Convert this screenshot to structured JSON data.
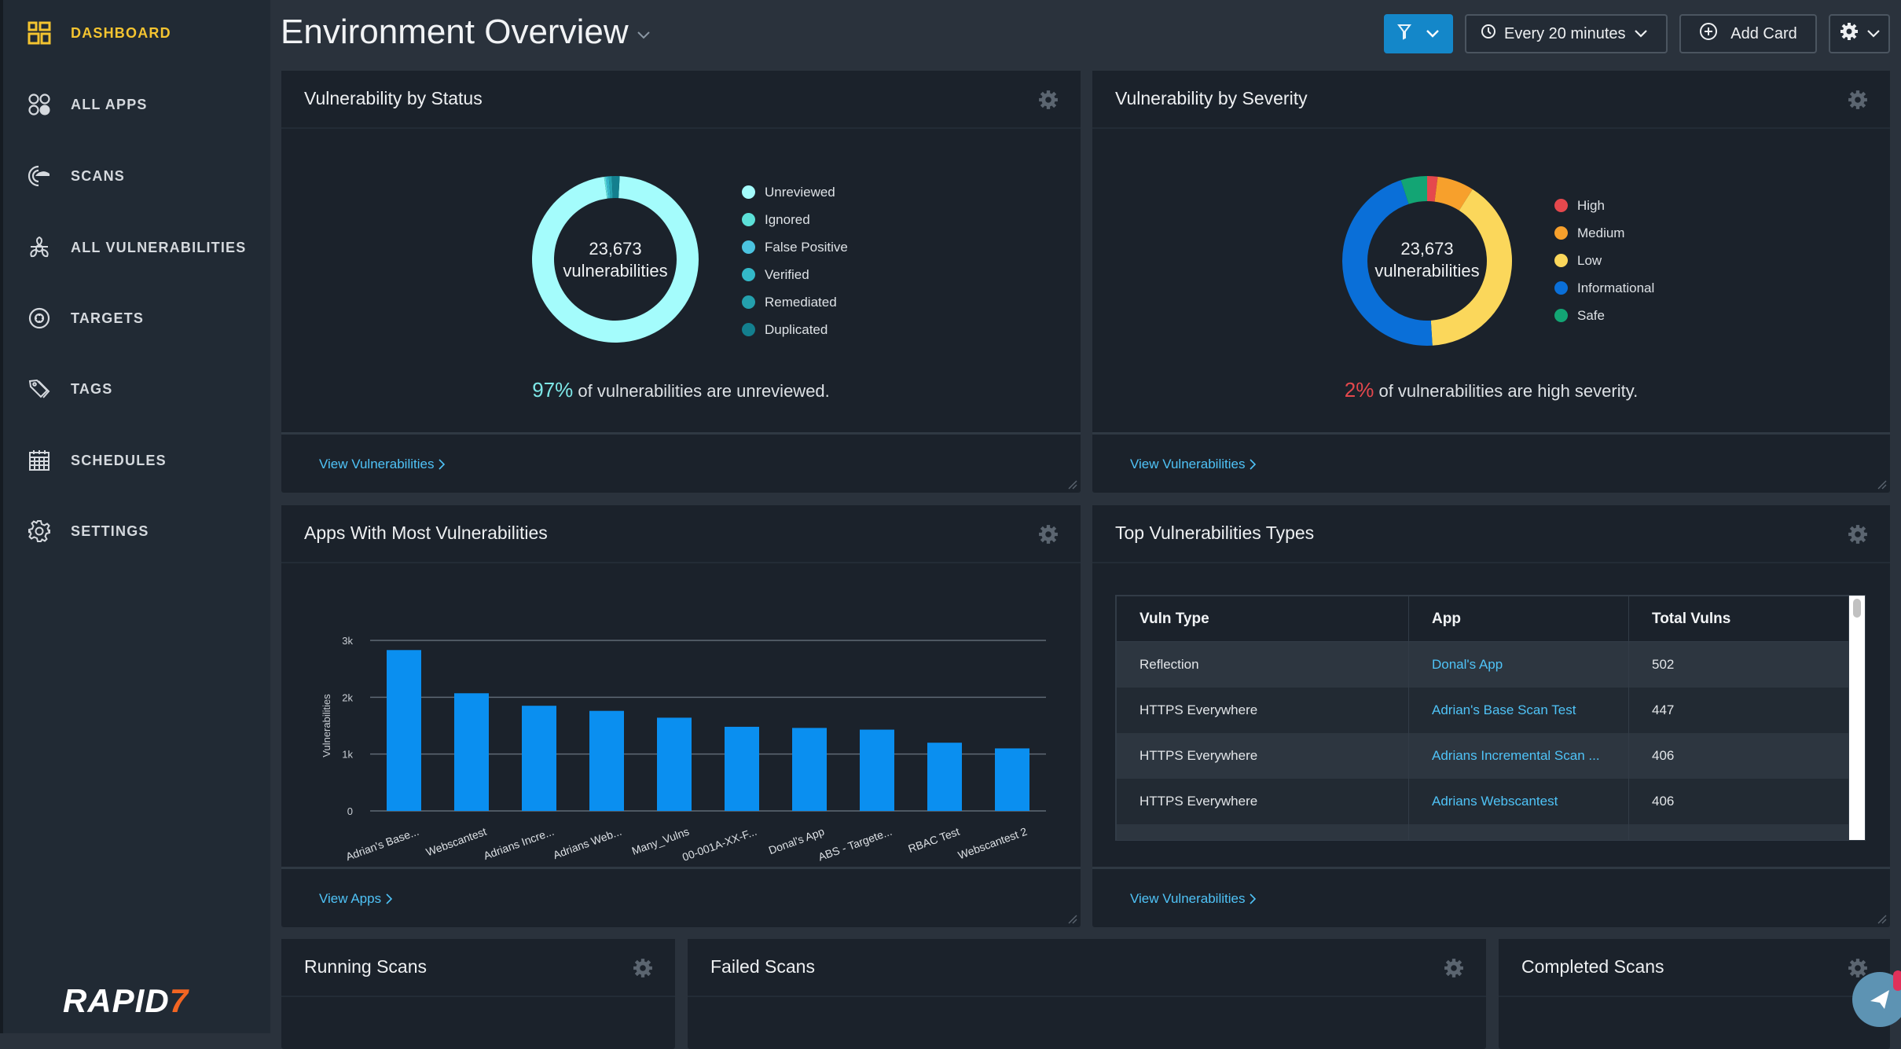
{
  "sidebar": {
    "items": [
      {
        "label": "DASHBOARD",
        "icon": "dashboard-grid-icon",
        "active": true
      },
      {
        "label": "ALL APPS",
        "icon": "apps-circles-icon"
      },
      {
        "label": "SCANS",
        "icon": "scans-radar-icon"
      },
      {
        "label": "ALL VULNERABILITIES",
        "icon": "biohazard-icon"
      },
      {
        "label": "TARGETS",
        "icon": "target-icon"
      },
      {
        "label": "TAGS",
        "icon": "tags-icon"
      },
      {
        "label": "SCHEDULES",
        "icon": "calendar-icon"
      },
      {
        "label": "SETTINGS",
        "icon": "gear-icon"
      }
    ],
    "logo": {
      "text": "RAPID",
      "mark": "7"
    }
  },
  "header": {
    "title": "Environment Overview",
    "refresh_label": "Every 20 minutes",
    "add_card_label": "Add Card"
  },
  "cards": {
    "status": {
      "title": "Vulnerability by Status",
      "total": "23,673",
      "total_label": "vulnerabilities",
      "summary_pct": "97%",
      "summary_text": " of vulnerabilities are unreviewed.",
      "summary_color": "#7ee8e8",
      "link": "View Vulnerabilities"
    },
    "severity": {
      "title": "Vulnerability by Severity",
      "total": "23,673",
      "total_label": "vulnerabilities",
      "summary_pct": "2%",
      "summary_text": " of vulnerabilities are high severity.",
      "summary_color": "#e5484d",
      "link": "View Vulnerabilities"
    },
    "apps": {
      "title": "Apps With Most Vulnerabilities",
      "link": "View Apps"
    },
    "types": {
      "title": "Top Vulnerabilities Types",
      "columns": [
        "Vuln Type",
        "App",
        "Total Vulns"
      ],
      "rows": [
        [
          "Reflection",
          "Donal's App",
          "502"
        ],
        [
          "HTTPS Everywhere",
          "Adrian's Base Scan Test",
          "447"
        ],
        [
          "HTTPS Everywhere",
          "Adrians Incremental Scan ...",
          "406"
        ],
        [
          "HTTPS Everywhere",
          "Adrians Webscantest",
          "406"
        ],
        [
          "",
          "",
          ""
        ]
      ],
      "link": "View Vulnerabilities"
    },
    "running": {
      "title": "Running Scans"
    },
    "failed": {
      "title": "Failed Scans"
    },
    "completed": {
      "title": "Completed Scans"
    }
  },
  "chart_data": [
    {
      "type": "pie",
      "title": "Vulnerability by Status",
      "categories": [
        "Unreviewed",
        "Ignored",
        "False Positive",
        "Verified",
        "Remediated",
        "Duplicated"
      ],
      "values": [
        97.0,
        0.3,
        0.2,
        0.4,
        0.6,
        1.5
      ],
      "colors": [
        "#a4fcfc",
        "#5ce0d8",
        "#4bc3e0",
        "#33b8c8",
        "#24a0ad",
        "#137f8e"
      ],
      "center_text": "23,673 vulnerabilities",
      "legend": "right"
    },
    {
      "type": "pie",
      "title": "Vulnerability by Severity",
      "categories": [
        "High",
        "Medium",
        "Low",
        "Informational",
        "Safe"
      ],
      "values": [
        2,
        7,
        40,
        46,
        5
      ],
      "colors": [
        "#e5484d",
        "#f7a02c",
        "#fbd75b",
        "#0a6fd8",
        "#13a574"
      ],
      "center_text": "23,673 vulnerabilities",
      "legend": "right"
    },
    {
      "type": "bar",
      "title": "Apps With Most Vulnerabilities",
      "categories": [
        "Adrian's Base...",
        "Webscantest",
        "Adrians Incre...",
        "Adrians Web...",
        "Many_Vulns",
        "00-001A-XX-F...",
        "Donal's App",
        "ABS - Targete...",
        "RBAC Test",
        "Webscantest 2"
      ],
      "values": [
        2830,
        2070,
        1850,
        1760,
        1640,
        1480,
        1460,
        1430,
        1200,
        1100
      ],
      "ylabel": "Vulnerabilities",
      "xlabel": "",
      "ylim": [
        0,
        3000
      ],
      "yticks": [
        "0",
        "1k",
        "2k",
        "3k"
      ],
      "ytick_values": [
        0,
        1000,
        2000,
        3000
      ],
      "grid": true,
      "bar_color": "#0a8ff0"
    }
  ]
}
